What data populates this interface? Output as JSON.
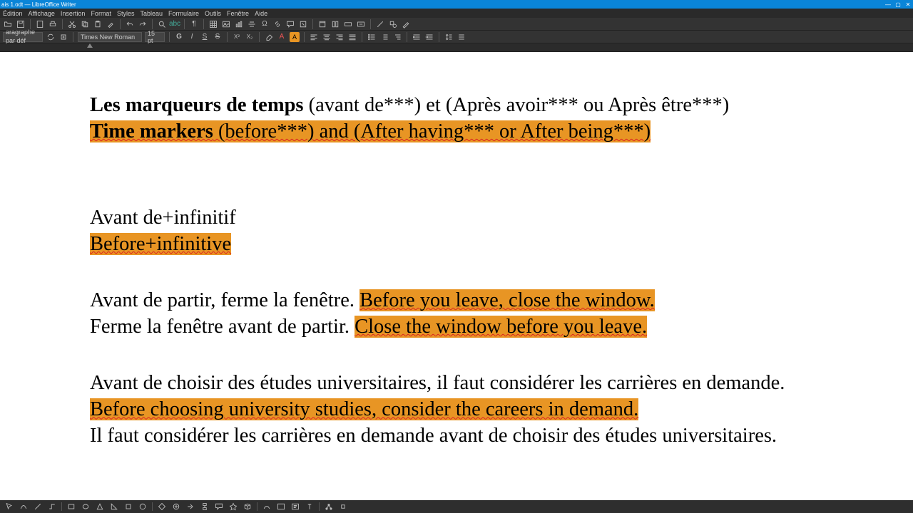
{
  "app": {
    "title": "ais 1.odt — LibreOffice Writer"
  },
  "menu": {
    "items": [
      "Édition",
      "Affichage",
      "Insertion",
      "Format",
      "Styles",
      "Tableau",
      "Formulaire",
      "Outils",
      "Fenêtre",
      "Aide"
    ]
  },
  "formatting": {
    "para_style": "aragraphe par déf",
    "font_name": "Times New Roman",
    "font_size": "15 pt",
    "bold_label": "G",
    "italic_label": "I",
    "under_label": "S",
    "strike_label": "S"
  },
  "document": {
    "title_line1_bold": "Les marqueurs de temps",
    "title_line1_rest": " (avant de***) et (Après avoir*** ou Après être***)",
    "title_line2_bold": "Time markers",
    "title_line2_rest": " (before***) and (After having*** or After being***)",
    "sec1_fr": "Avant de+infinitif",
    "sec1_en": "Before+infinitive",
    "ex1_fr": "Avant de partir, ferme la fenêtre. ",
    "ex1_en": "Before you leave, close the window.",
    "ex2_fr": "Ferme la fenêtre avant de partir. ",
    "ex2_en": "Close the window before you leave.",
    "ex3_fr": "Avant de choisir des études universitaires, il faut considérer les carrières en demande.",
    "ex3_en": "Before choosing university studies, consider the careers in demand.",
    "ex4_fr": "Il faut considérer les carrières en demande avant de choisir des études universitaires."
  },
  "colors": {
    "highlight": "#e89524",
    "titlebar": "#0a85d8"
  }
}
